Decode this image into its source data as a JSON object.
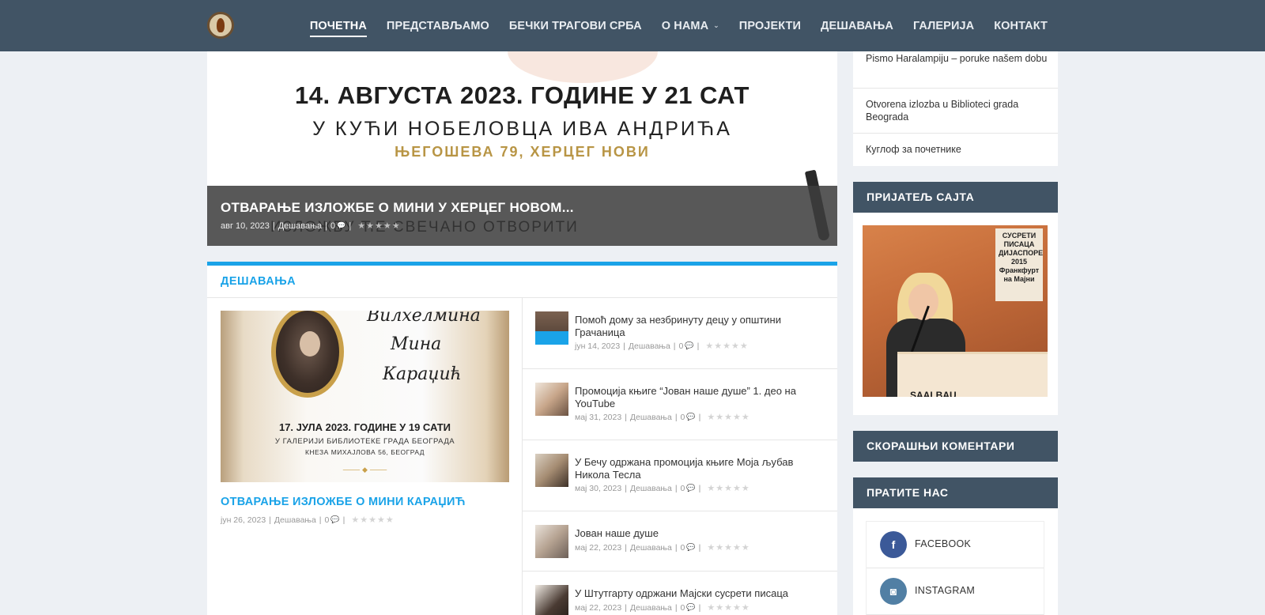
{
  "nav": {
    "items": [
      {
        "label": "ПОЧЕТНА",
        "active": true
      },
      {
        "label": "ПРЕДСТАВЉАМО"
      },
      {
        "label": "БЕЧКИ ТРАГОВИ СРБА"
      },
      {
        "label": "О НАМА",
        "dropdown": true
      },
      {
        "label": "ПРОЈЕКТИ"
      },
      {
        "label": "ДЕШАВАЊА"
      },
      {
        "label": "ГАЛЕРИЈА"
      },
      {
        "label": "КОНТАКТ"
      }
    ],
    "dropdown_glyph": "⌄"
  },
  "featured": {
    "image_line1": "14. АВГУСТА 2023. ГОДИНЕ У 21 САТ",
    "image_line2": "У КУЋИ НОБЕЛОВЦА ИВА АНДРИЋА",
    "image_line3": "ЊЕГОШЕВА 79, ХЕРЦЕГ НОВИ",
    "image_line4": "ИЗЛОЖБУ ЋЕ СВЕЧАНО ОТВОРИТИ",
    "title": "ОТВАРАЊЕ ИЗЛОЖБЕ О МИНИ У ХЕРЦЕГ НОВОМ...",
    "date": "авг 10, 2023",
    "category": "Дешавања",
    "comments": "0"
  },
  "section": {
    "title": "ДЕШАВАЊА",
    "main": {
      "image_script1": "Вилхелмина",
      "image_script2": "Мина",
      "image_script3": "Караџић",
      "image_line1": "17. ЈУЛА 2023. ГОДИНЕ У 19 САТИ",
      "image_line2": "У ГАЛЕРИЈИ БИБЛИОТЕКЕ ГРАДА БЕОГРАДА",
      "image_line3": "КНЕЗА МИХАЈЛОВА 56, БЕОГРАД",
      "title": "ОТВАРАЊЕ ИЗЛОЖБЕ О МИНИ КАРАЏИЋ",
      "date": "јун 26, 2023",
      "category": "Дешавања",
      "comments": "0"
    },
    "list": [
      {
        "title": "Помоћ дому за незбринуту децу у општини Грачаница",
        "date": "јун 14, 2023",
        "category": "Дешавања",
        "comments": "0"
      },
      {
        "title": "Промоција књиге “Јован наше душе” 1. део на YouTube",
        "date": "мај 31, 2023",
        "category": "Дешавања",
        "comments": "0"
      },
      {
        "title": "У Бечу одржана промоција књиге Моја љубав Никола Тесла",
        "date": "мај 30, 2023",
        "category": "Дешавања",
        "comments": "0"
      },
      {
        "title": "Јован наше душе",
        "date": "мај 22, 2023",
        "category": "Дешавања",
        "comments": "0"
      },
      {
        "title": "У Штутгарту одржани Мајски сусрети писаца",
        "date": "мај 22, 2023",
        "category": "Дешавања",
        "comments": "0"
      }
    ]
  },
  "sidebar": {
    "recent_posts": [
      "Pismo Haralampiju – poruke našem dobu",
      "Otvorena izlozba u Biblioteci grada Beograda",
      "Куглоф за почетнике"
    ],
    "friend_title": "ПРИЈАТЕЉ САЈТА",
    "friend_image_poster": "СУСРЕТИ ПИСАЦА ДИЈАСПОРЕ 2015 Франкфурт на Мајни",
    "friend_image_label": "SAALBAU",
    "comments_title": "СКОРАШЊИ КОМЕНТАРИ",
    "follow_title": "ПРАТИТЕ НАС",
    "social": [
      {
        "label": "FACEBOOK",
        "glyph": "f",
        "color": "#3b5998"
      },
      {
        "label": "INSTAGRAM",
        "glyph": "◙",
        "color": "#517fa4"
      }
    ]
  },
  "meta": {
    "separator": "|",
    "comment_glyph": "💬",
    "star_glyph": "★",
    "rating_stars": 5
  }
}
